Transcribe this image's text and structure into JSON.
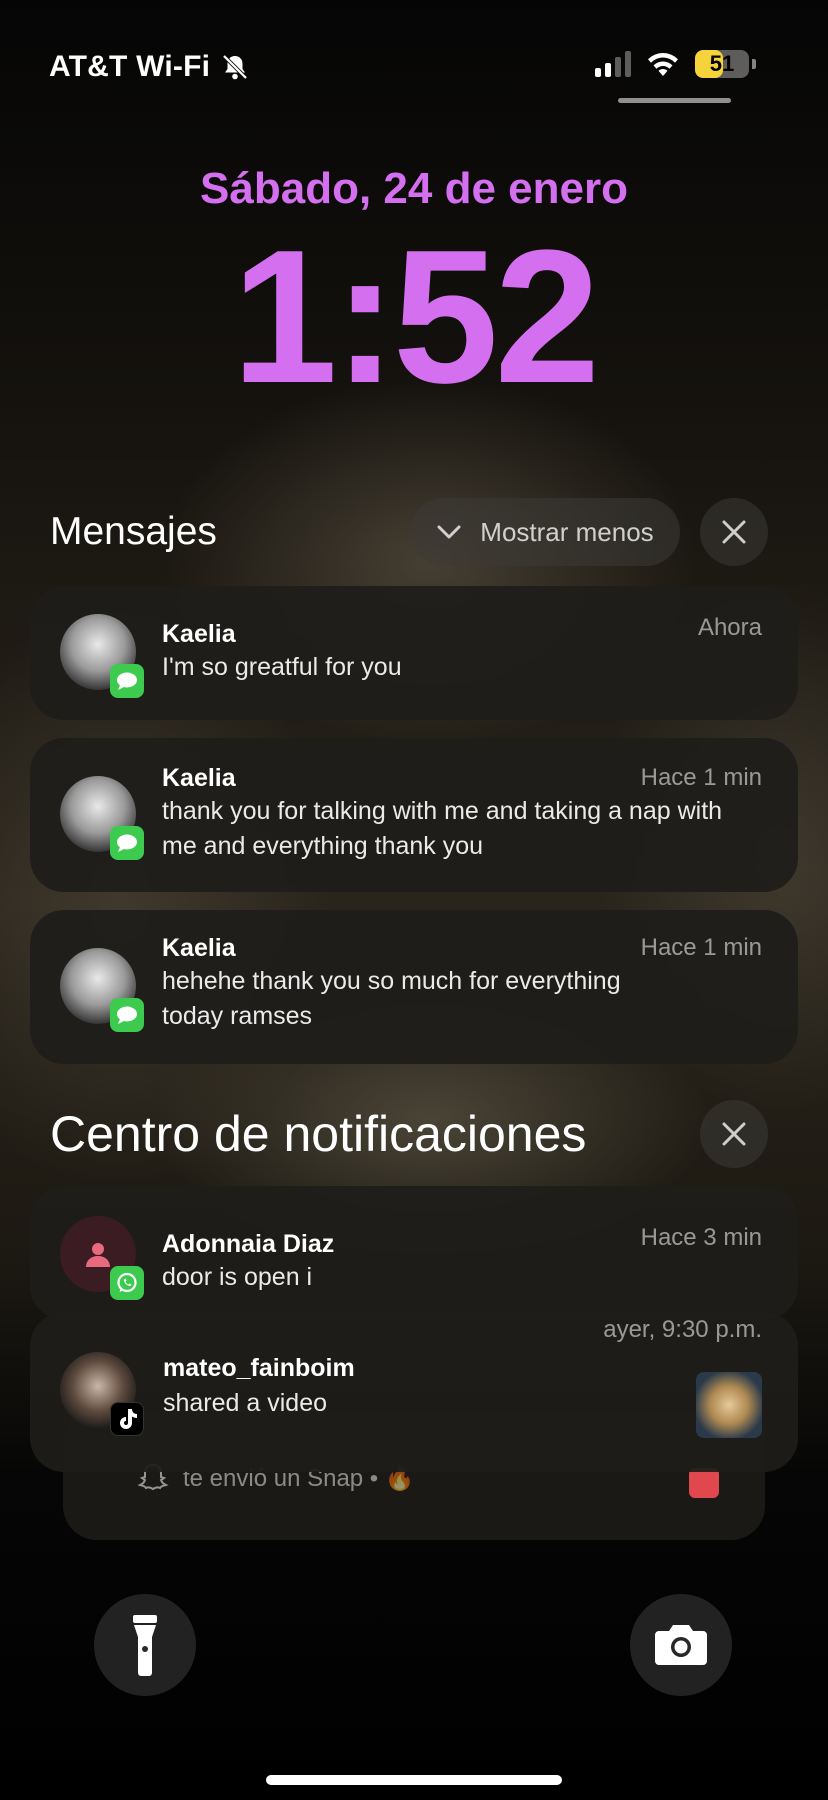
{
  "status_bar": {
    "carrier": "AT&T Wi-Fi",
    "icons": [
      "bell-slash-icon",
      "signal-icon",
      "wifi-icon",
      "battery-icon"
    ],
    "battery_level": "51",
    "battery_fraction": 0.51,
    "battery_color": "#f5d33a"
  },
  "lock_screen": {
    "date": "Sábado, 24 de enero",
    "time": "1:52",
    "accent_color": "#d46ff0"
  },
  "messages_group": {
    "title": "Mensajes",
    "show_less_label": "Mostrar menos",
    "notifications": [
      {
        "sender": "Kaelia",
        "time": "Ahora",
        "text": "I'm so greatful for you",
        "app": "Messages"
      },
      {
        "sender": "Kaelia",
        "time": "Hace 1 min",
        "text": "thank you for talking with me and taking a nap with me and everything thank you",
        "app": "Messages"
      },
      {
        "sender": "Kaelia",
        "time": "Hace 1 min",
        "text": "hehehe thank you so much for everything today ramses",
        "app": "Messages"
      }
    ]
  },
  "notification_center": {
    "title": "Centro de notificaciones",
    "notifications": [
      {
        "sender": "Adonnaia Diaz",
        "time": "Hace 3 min",
        "text": "door is open i",
        "app": "WhatsApp"
      },
      {
        "sender": "mateo_fainboim",
        "time": "ayer, 9:30 p.m.",
        "text": "shared a video",
        "app": "TikTok"
      }
    ],
    "stacked_preview": {
      "text": "te envió un Snap • 🔥",
      "app": "Snapchat"
    }
  },
  "quick_actions": {
    "left": "flashlight-icon",
    "right": "camera-icon"
  }
}
